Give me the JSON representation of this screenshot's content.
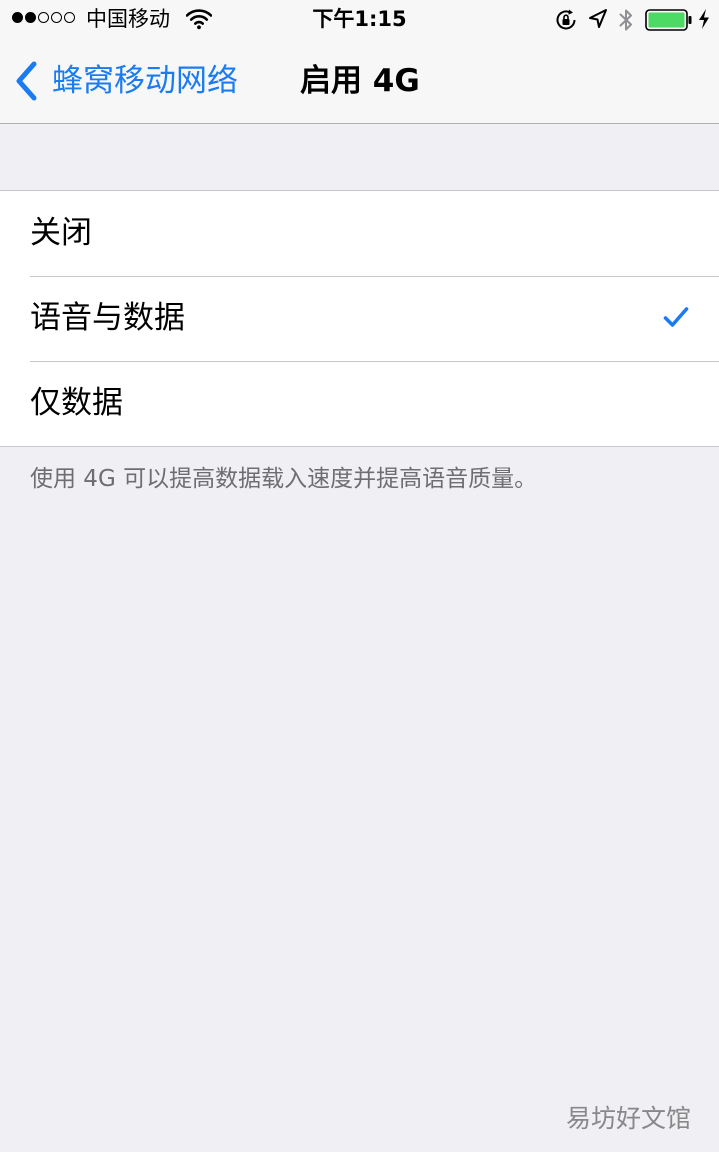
{
  "status_bar": {
    "signal": {
      "filled": 2,
      "total": 5
    },
    "carrier": "中国移动",
    "time": "下午1:15",
    "battery_color": "#4cd964",
    "icons": [
      "wifi-icon",
      "rotation-lock-icon",
      "location-arrow-icon",
      "bluetooth-icon",
      "battery-icon",
      "charging-bolt-icon"
    ]
  },
  "nav": {
    "back_label": "蜂窝移动网络",
    "title": "启用 4G",
    "accent_color": "#1a7cf0"
  },
  "options": [
    {
      "label": "关闭",
      "selected": false
    },
    {
      "label": "语音与数据",
      "selected": true
    },
    {
      "label": "仅数据",
      "selected": false
    }
  ],
  "footer_note": "使用 4G 可以提高数据载入速度并提高语音质量。",
  "watermark": "易坊好文馆"
}
